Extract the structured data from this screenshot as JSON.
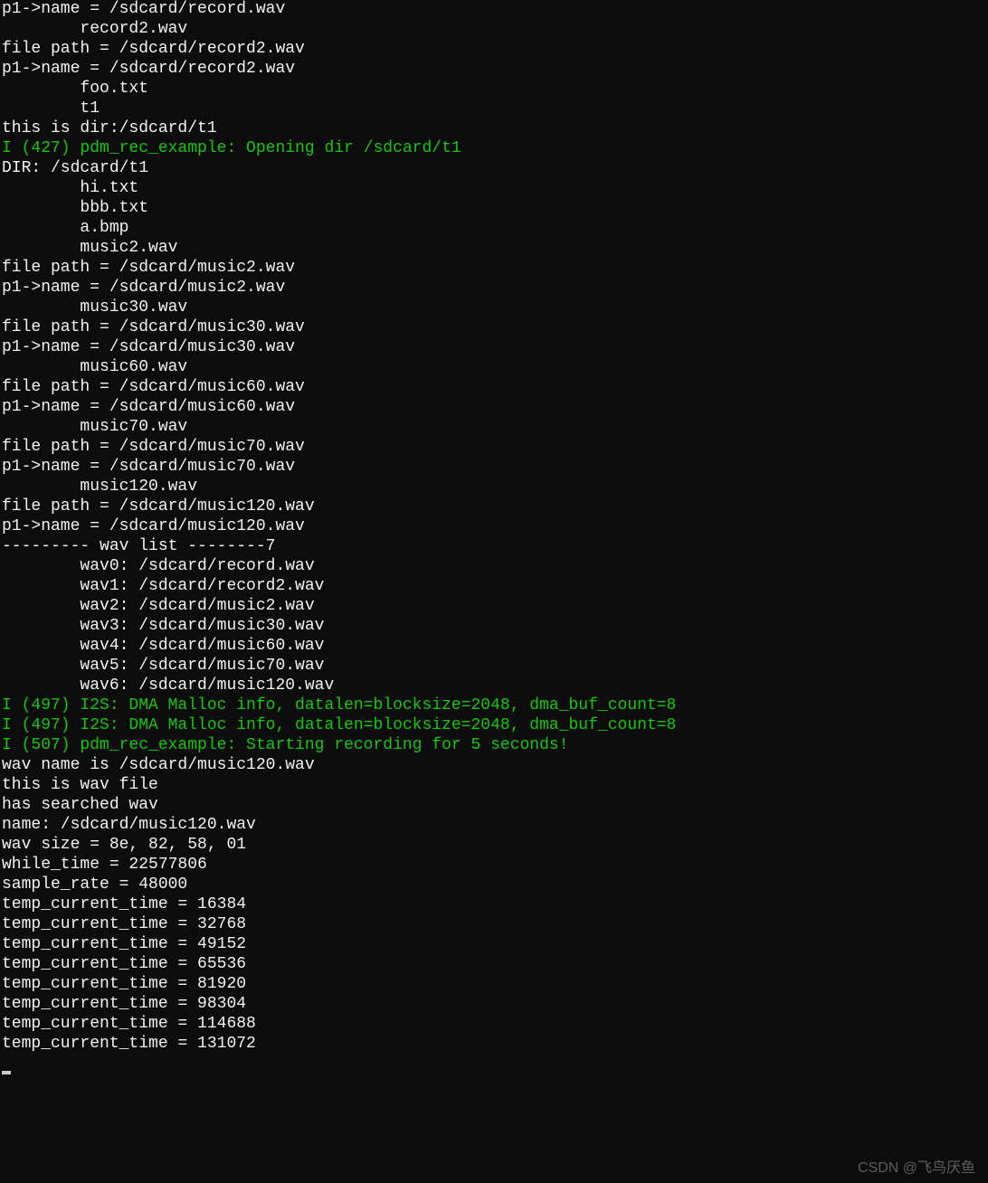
{
  "lines": [
    {
      "text": "p1->name = /sdcard/record.wav",
      "cls": "white"
    },
    {
      "text": "        record2.wav",
      "cls": "white"
    },
    {
      "text": "file path = /sdcard/record2.wav",
      "cls": "white"
    },
    {
      "text": "p1->name = /sdcard/record2.wav",
      "cls": "white"
    },
    {
      "text": "        foo.txt",
      "cls": "white"
    },
    {
      "text": "        t1",
      "cls": "white"
    },
    {
      "text": "this is dir:/sdcard/t1",
      "cls": "white"
    },
    {
      "text": "I (427) pdm_rec_example: Opening dir /sdcard/t1",
      "cls": "green"
    },
    {
      "text": "DIR: /sdcard/t1",
      "cls": "white"
    },
    {
      "text": "        hi.txt",
      "cls": "white"
    },
    {
      "text": "        bbb.txt",
      "cls": "white"
    },
    {
      "text": "        a.bmp",
      "cls": "white"
    },
    {
      "text": "        music2.wav",
      "cls": "white"
    },
    {
      "text": "file path = /sdcard/music2.wav",
      "cls": "white"
    },
    {
      "text": "p1->name = /sdcard/music2.wav",
      "cls": "white"
    },
    {
      "text": "        music30.wav",
      "cls": "white"
    },
    {
      "text": "file path = /sdcard/music30.wav",
      "cls": "white"
    },
    {
      "text": "p1->name = /sdcard/music30.wav",
      "cls": "white"
    },
    {
      "text": "        music60.wav",
      "cls": "white"
    },
    {
      "text": "file path = /sdcard/music60.wav",
      "cls": "white"
    },
    {
      "text": "p1->name = /sdcard/music60.wav",
      "cls": "white"
    },
    {
      "text": "        music70.wav",
      "cls": "white"
    },
    {
      "text": "file path = /sdcard/music70.wav",
      "cls": "white"
    },
    {
      "text": "p1->name = /sdcard/music70.wav",
      "cls": "white"
    },
    {
      "text": "        music120.wav",
      "cls": "white"
    },
    {
      "text": "file path = /sdcard/music120.wav",
      "cls": "white"
    },
    {
      "text": "p1->name = /sdcard/music120.wav",
      "cls": "white"
    },
    {
      "text": "--------- wav list --------7",
      "cls": "white"
    },
    {
      "text": "        wav0: /sdcard/record.wav",
      "cls": "white"
    },
    {
      "text": "        wav1: /sdcard/record2.wav",
      "cls": "white"
    },
    {
      "text": "        wav2: /sdcard/music2.wav",
      "cls": "white"
    },
    {
      "text": "        wav3: /sdcard/music30.wav",
      "cls": "white"
    },
    {
      "text": "        wav4: /sdcard/music60.wav",
      "cls": "white"
    },
    {
      "text": "        wav5: /sdcard/music70.wav",
      "cls": "white"
    },
    {
      "text": "        wav6: /sdcard/music120.wav",
      "cls": "white"
    },
    {
      "text": "I (497) I2S: DMA Malloc info, datalen=blocksize=2048, dma_buf_count=8",
      "cls": "green"
    },
    {
      "text": "I (497) I2S: DMA Malloc info, datalen=blocksize=2048, dma_buf_count=8",
      "cls": "green"
    },
    {
      "text": "I (507) pdm_rec_example: Starting recording for 5 seconds!",
      "cls": "green"
    },
    {
      "text": "wav name is /sdcard/music120.wav",
      "cls": "white"
    },
    {
      "text": "this is wav file",
      "cls": "white"
    },
    {
      "text": "has searched wav",
      "cls": "white"
    },
    {
      "text": "name: /sdcard/music120.wav",
      "cls": "white"
    },
    {
      "text": "wav size = 8e, 82, 58, 01",
      "cls": "white"
    },
    {
      "text": "while_time = 22577806",
      "cls": "white"
    },
    {
      "text": "sample_rate = 48000",
      "cls": "white"
    },
    {
      "text": "temp_current_time = 16384",
      "cls": "white"
    },
    {
      "text": "temp_current_time = 32768",
      "cls": "white"
    },
    {
      "text": "temp_current_time = 49152",
      "cls": "white"
    },
    {
      "text": "temp_current_time = 65536",
      "cls": "white"
    },
    {
      "text": "temp_current_time = 81920",
      "cls": "white"
    },
    {
      "text": "temp_current_time = 98304",
      "cls": "white"
    },
    {
      "text": "temp_current_time = 114688",
      "cls": "white"
    },
    {
      "text": "temp_current_time = 131072",
      "cls": "white"
    }
  ],
  "watermark": "CSDN @飞鸟厌鱼"
}
